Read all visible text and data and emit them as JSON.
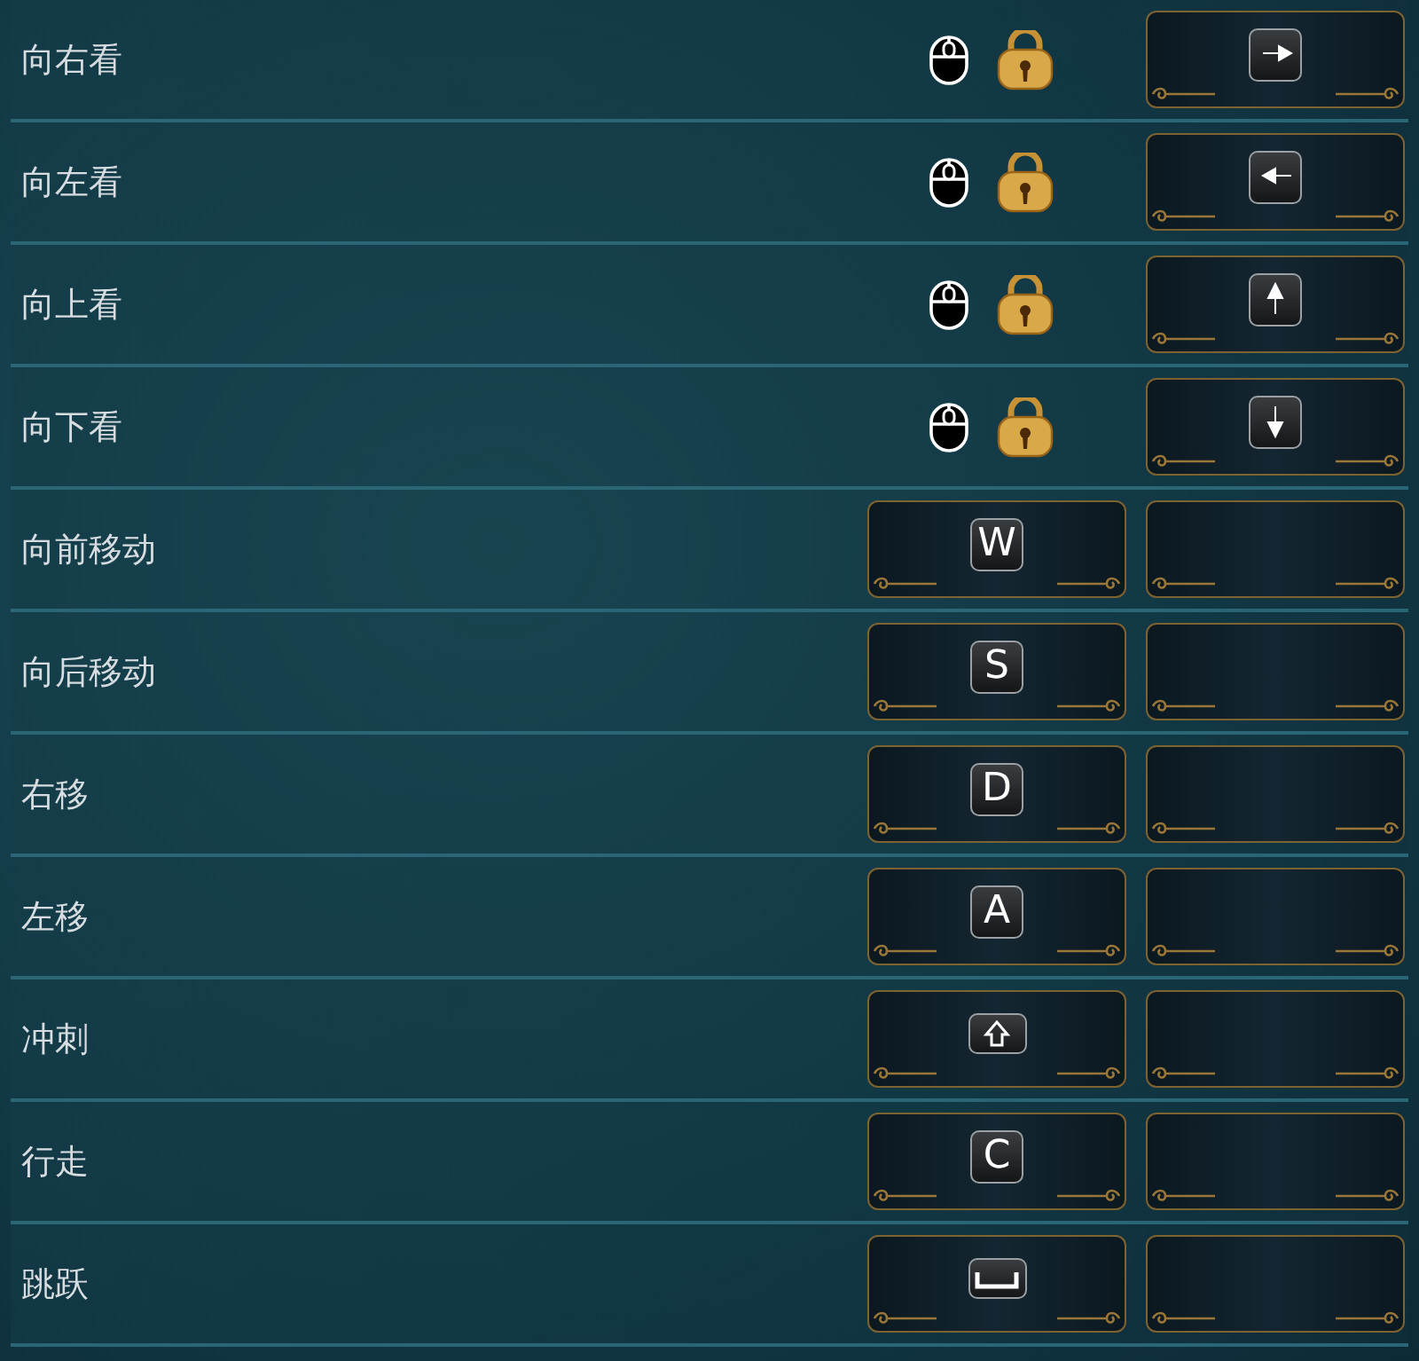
{
  "bindings": [
    {
      "action": "向右看",
      "locked": true,
      "keys": [
        {
          "kind": "arrow-right"
        }
      ]
    },
    {
      "action": "向左看",
      "locked": true,
      "keys": [
        {
          "kind": "arrow-left"
        }
      ]
    },
    {
      "action": "向上看",
      "locked": true,
      "keys": [
        {
          "kind": "arrow-up"
        }
      ]
    },
    {
      "action": "向下看",
      "locked": true,
      "keys": [
        {
          "kind": "arrow-down"
        }
      ]
    },
    {
      "action": "向前移动",
      "locked": false,
      "keys": [
        {
          "kind": "letter",
          "label": "W"
        },
        {
          "kind": "empty"
        }
      ]
    },
    {
      "action": "向后移动",
      "locked": false,
      "keys": [
        {
          "kind": "letter",
          "label": "S"
        },
        {
          "kind": "empty"
        }
      ]
    },
    {
      "action": "右移",
      "locked": false,
      "keys": [
        {
          "kind": "letter",
          "label": "D"
        },
        {
          "kind": "empty"
        }
      ]
    },
    {
      "action": "左移",
      "locked": false,
      "keys": [
        {
          "kind": "letter",
          "label": "A"
        },
        {
          "kind": "empty"
        }
      ]
    },
    {
      "action": "冲刺",
      "locked": false,
      "keys": [
        {
          "kind": "shift"
        },
        {
          "kind": "empty"
        }
      ]
    },
    {
      "action": "行走",
      "locked": false,
      "keys": [
        {
          "kind": "letter",
          "label": "C"
        },
        {
          "kind": "empty"
        }
      ]
    },
    {
      "action": "跳跃",
      "locked": false,
      "keys": [
        {
          "kind": "space"
        },
        {
          "kind": "empty"
        }
      ]
    }
  ]
}
